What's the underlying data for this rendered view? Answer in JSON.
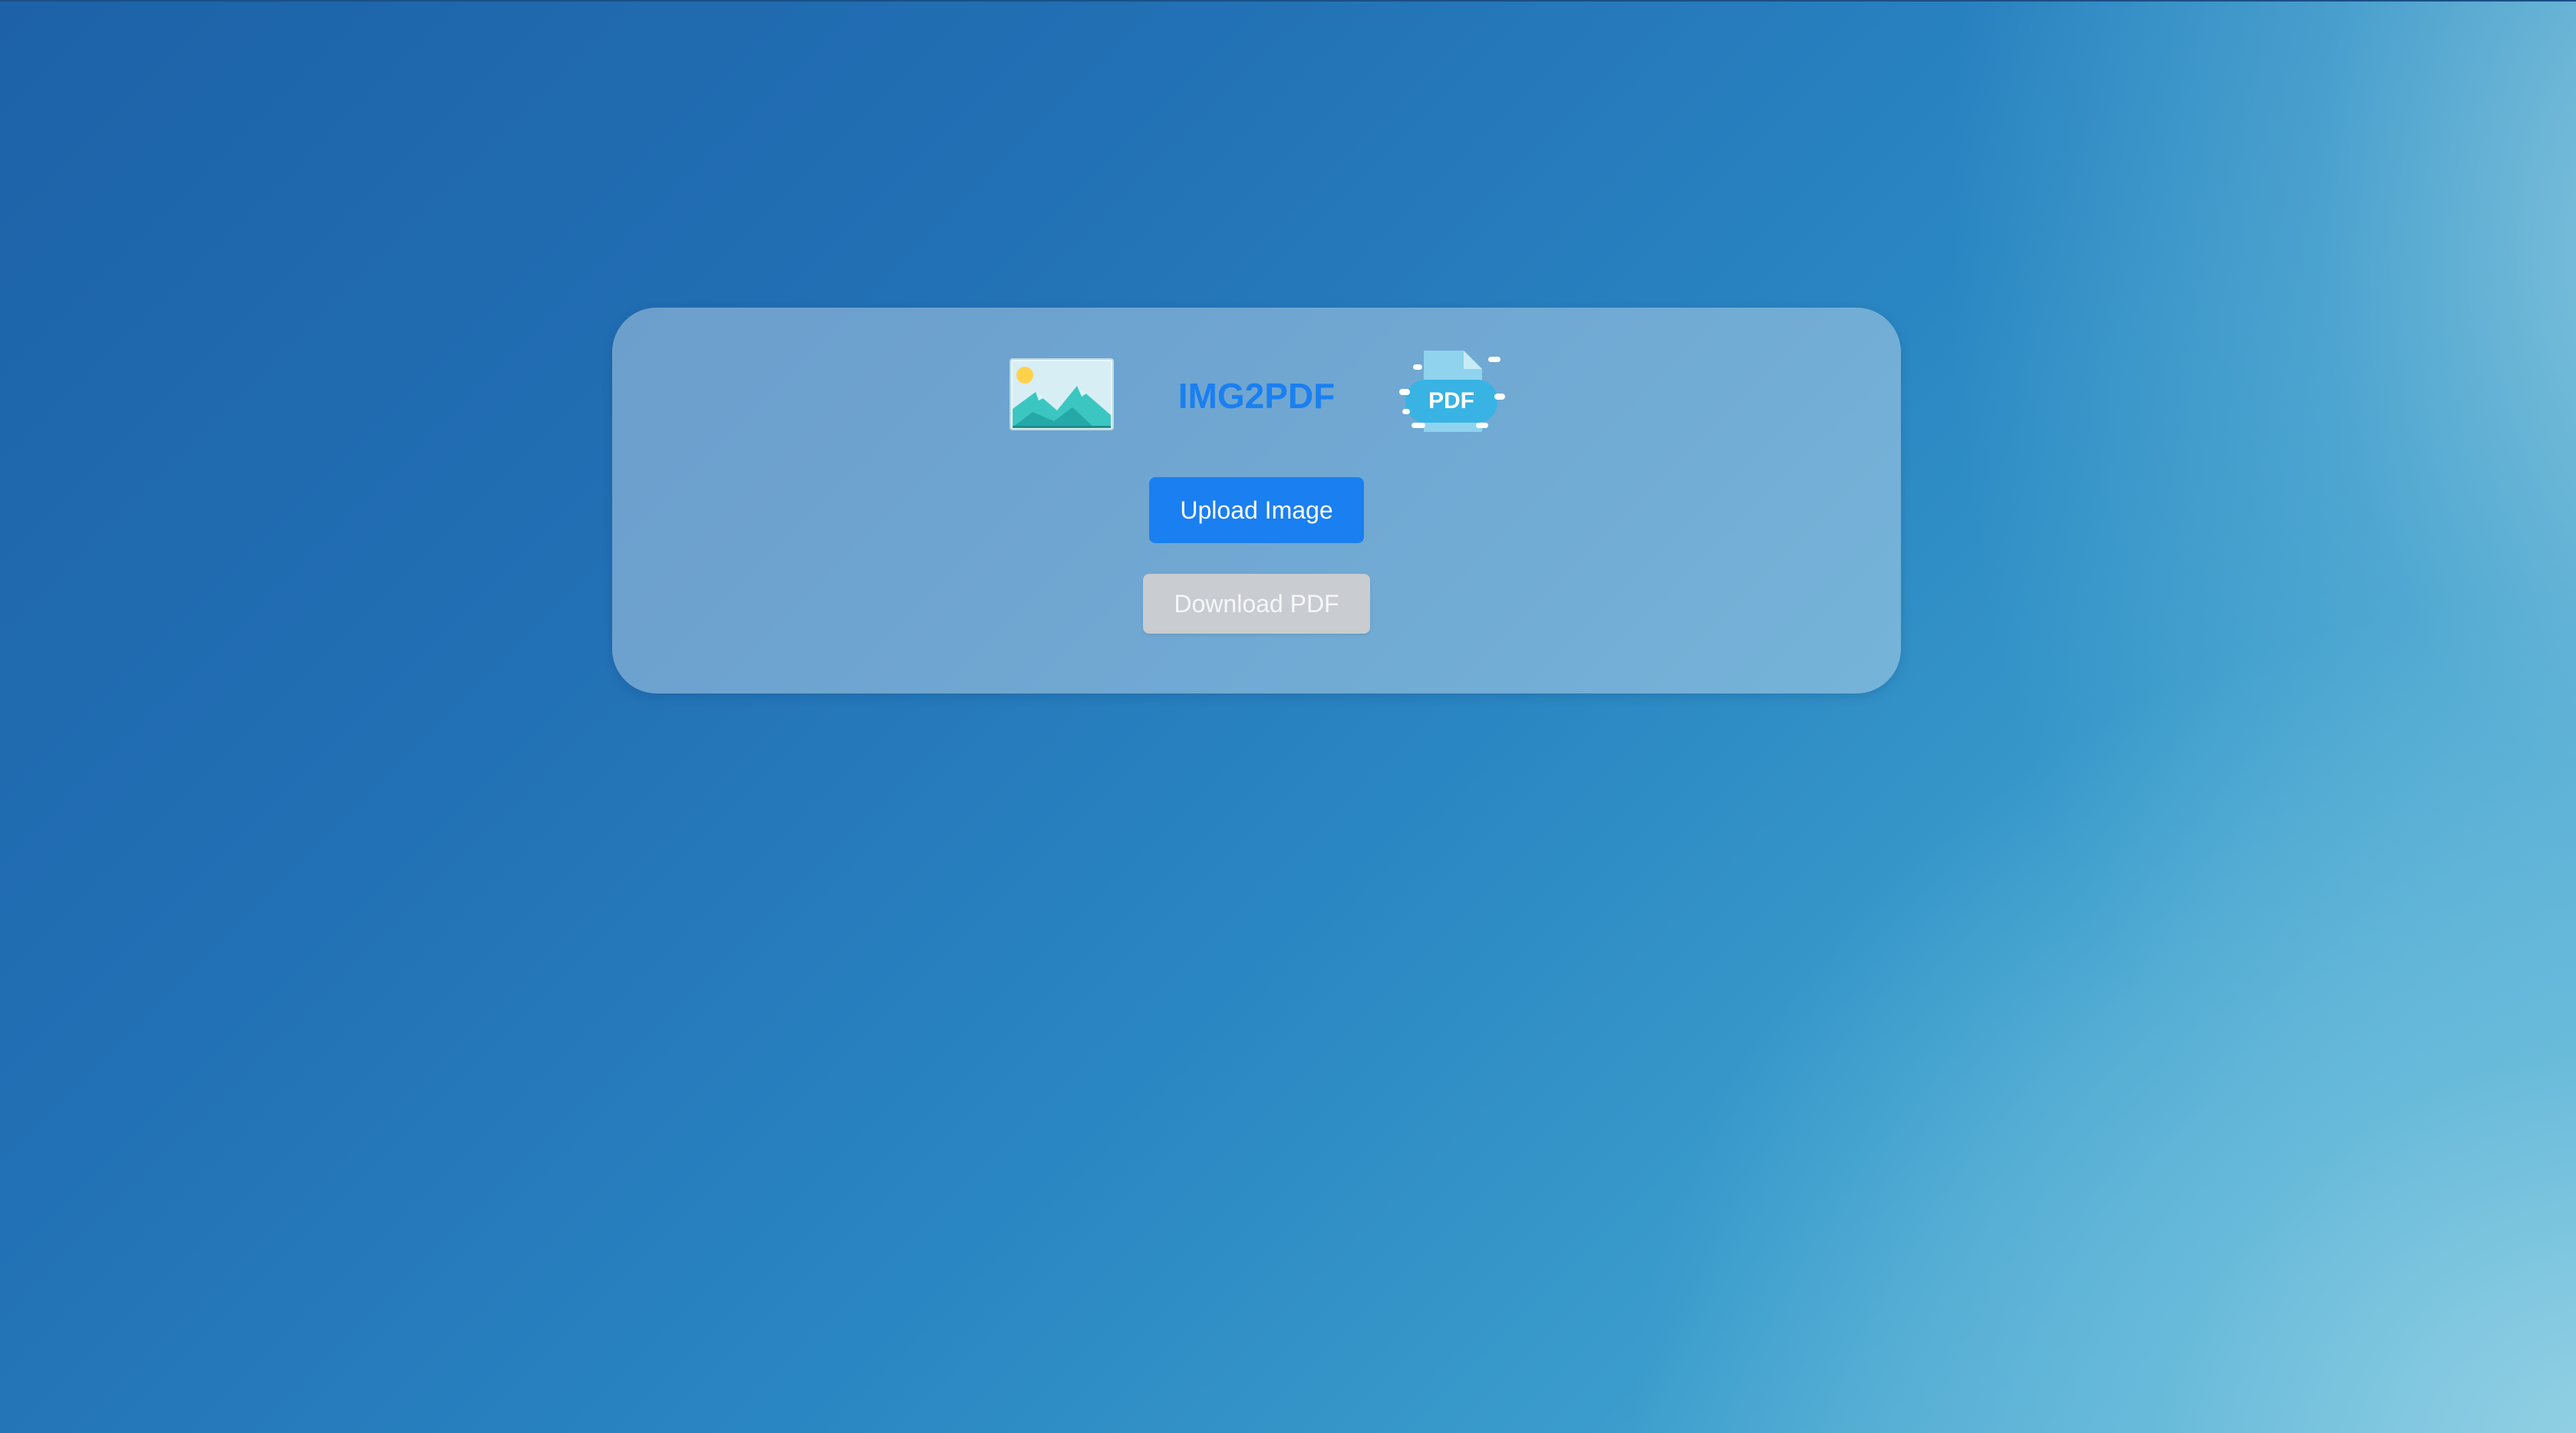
{
  "app": {
    "title": "IMG2PDF"
  },
  "icons": {
    "left": "image-landscape-icon",
    "right": "pdf-document-icon",
    "pdf_badge_text": "PDF"
  },
  "actions": {
    "upload_label": "Upload Image",
    "download_label": "Download PDF",
    "download_enabled": false
  },
  "colors": {
    "accent": "#1a7ff0",
    "disabled_button": "#c9ccd1"
  }
}
